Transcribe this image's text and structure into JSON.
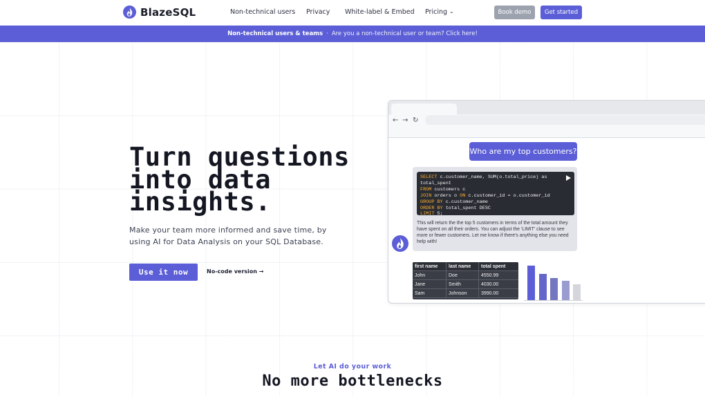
{
  "brand": {
    "name": "BlazeSQL",
    "logo_icon": "flame-logo-icon"
  },
  "nav": {
    "items": [
      {
        "label": "Non-technical users"
      },
      {
        "label": "Privacy"
      },
      {
        "label": "White-label & Embed"
      },
      {
        "label": "Pricing",
        "has_dropdown": true
      }
    ],
    "book_demo_label": "Book demo",
    "get_started_label": "Get started"
  },
  "announcement": {
    "strong": "Non-technical users & teams",
    "separator": "·",
    "message": "Are you a non-technical user or team? Click here!"
  },
  "hero": {
    "title_lines": [
      "Turn questions",
      "into data",
      "insights."
    ],
    "subtitle": "Make your team more informed and save time, by using AI for Data Analysis on your SQL Database.",
    "cta_label": "Use it now",
    "secondary_link": "No-code version →"
  },
  "mockup": {
    "question": "Who are my top customers?",
    "sql_lines": [
      {
        "kw": "SELECT",
        "rest": " c.customer_name, SUM(o.total_price) as total_spent"
      },
      {
        "kw": "FROM",
        "rest": " customers c"
      },
      {
        "kw": "JOIN",
        "rest": " orders o ",
        "kw2": "ON",
        "rest2": " c.customer_id = o.customer_id"
      },
      {
        "kw": "GROUP BY",
        "rest": " c.customer_name"
      },
      {
        "kw": "ORDER BY",
        "rest": " total_spent DESC"
      },
      {
        "kw": "LIMIT",
        "rest": " 5;"
      }
    ],
    "explanation": "This will return the the top 5 customers in terms of the total amount they have spent on all their orders. You can adjust the 'LIMIT' clause to see more or fewer customers. Let me know if there's anything else you need help with!",
    "table": {
      "headers": [
        "first name",
        "last name",
        "total spent"
      ],
      "rows": [
        [
          "John",
          "Doe",
          "4550.99"
        ],
        [
          "Jane",
          "Smith",
          "4030.00"
        ],
        [
          "Sam",
          "Johnson",
          "3990.00"
        ]
      ]
    },
    "chart_colors": [
      "#5b5ed6",
      "#6466c9",
      "#7477bf",
      "#9a9cd0",
      "#d5d6dc"
    ],
    "chart_levels": [
      1.0,
      0.76,
      0.64,
      0.56,
      0.46
    ]
  },
  "section": {
    "eyebrow": "Let AI do your work",
    "heading": "No more bottlenecks"
  },
  "colors": {
    "accent": "#5b5ed6",
    "demo_button": "#9ca3af",
    "sql_keyword": "#ffb02e"
  }
}
